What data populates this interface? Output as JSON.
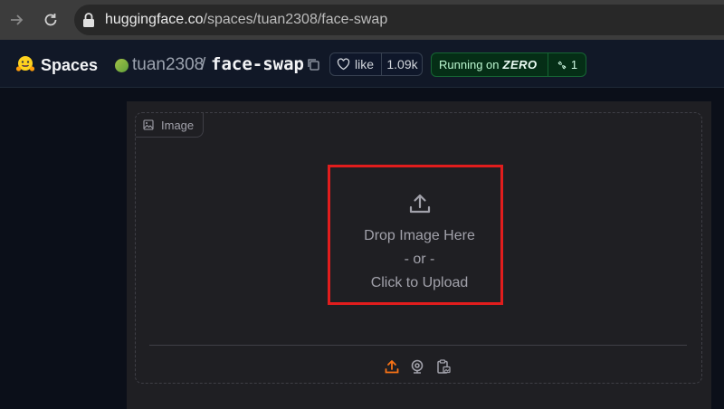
{
  "browser": {
    "url_host": "huggingface.co",
    "url_path": "/spaces/tuan2308/face-swap"
  },
  "header": {
    "brand": "Spaces",
    "owner": "tuan2308",
    "separator": "/",
    "repo": "face-swap",
    "like_label": "like",
    "like_count": "1.09k",
    "status_prefix": "Running on",
    "status_hardware": "ZERO",
    "status_count": "1",
    "colors": {
      "running": "#166534",
      "accent": "#f97316"
    }
  },
  "image_input": {
    "label": "Image",
    "drop_line1": "Drop Image Here",
    "drop_line2": "- or -",
    "drop_line3": "Click to Upload",
    "sources": [
      "upload-icon",
      "webcam-icon",
      "clipboard-icon"
    ]
  }
}
